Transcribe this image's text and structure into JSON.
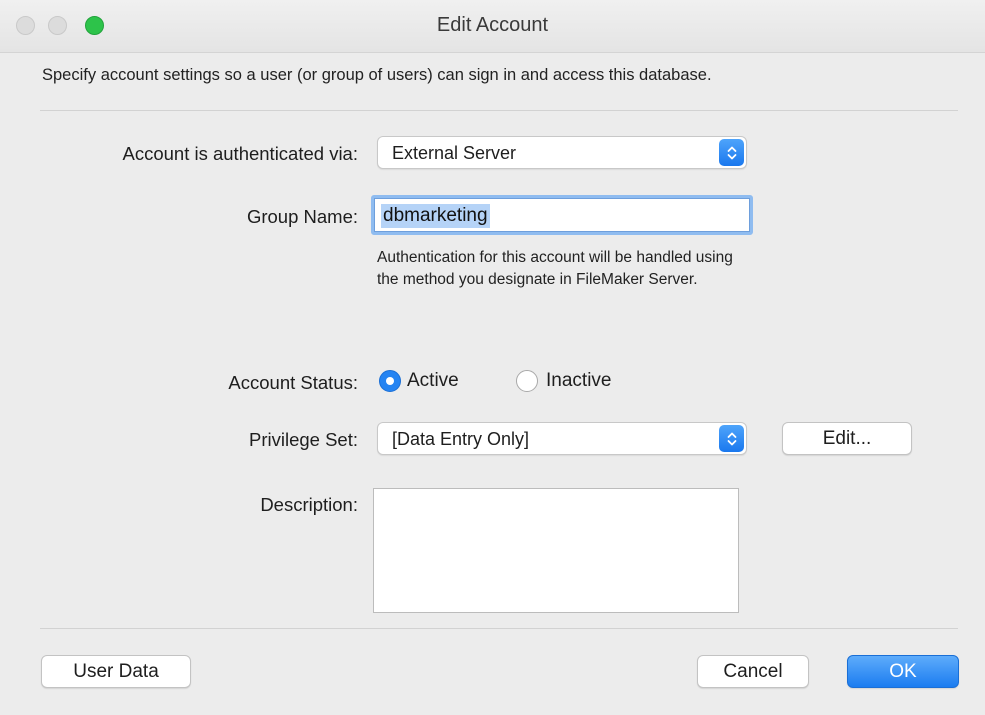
{
  "window": {
    "title": "Edit Account"
  },
  "intro_text": "Specify account settings so a user (or group of users) can sign in and access this database.",
  "auth": {
    "label": "Account is authenticated via:",
    "value": "External Server"
  },
  "group": {
    "label": "Group Name:",
    "value": "dbmarketing"
  },
  "help_text": {
    "line1": "Authentication for this account will be handled using",
    "line2": "the method you designate in FileMaker Server."
  },
  "status": {
    "label": "Account Status:",
    "options": [
      {
        "label": "Active",
        "selected": true
      },
      {
        "label": "Inactive",
        "selected": false
      }
    ]
  },
  "privilege": {
    "label": "Privilege Set:",
    "value": "[Data Entry Only]",
    "edit_label": "Edit..."
  },
  "description": {
    "label": "Description:",
    "value": ""
  },
  "buttons": {
    "user_data": "User Data",
    "cancel": "Cancel",
    "ok": "OK"
  },
  "colors": {
    "accent": "#2584f2",
    "zoom_button": "#2dc34a",
    "selection": "#b5d3f7"
  },
  "icons": {
    "popup_arrows": "chevron-up-down-icon",
    "radio_selected": "radio-selected-icon",
    "radio_unselected": "radio-unselected-icon"
  }
}
